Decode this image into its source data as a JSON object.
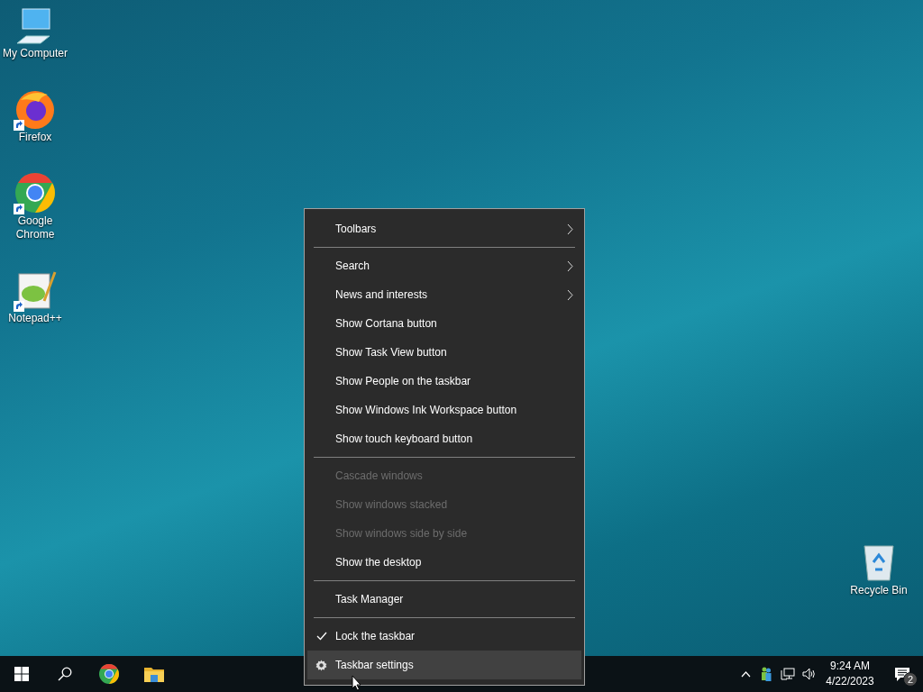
{
  "desktop_icons": [
    {
      "label": "My Computer",
      "kind": "computer",
      "shortcut": false
    },
    {
      "label": "Firefox",
      "kind": "firefox",
      "shortcut": true
    },
    {
      "label": "Google Chrome",
      "kind": "chrome",
      "shortcut": true
    },
    {
      "label": "Notepad++",
      "kind": "notepad",
      "shortcut": true
    }
  ],
  "recycle_bin": {
    "label": "Recycle Bin"
  },
  "context_menu": [
    {
      "kind": "item",
      "label": "Toolbars",
      "submenu": true,
      "disabled": false,
      "checked": false,
      "selected": false
    },
    {
      "kind": "separator"
    },
    {
      "kind": "item",
      "label": "Search",
      "submenu": true,
      "disabled": false,
      "checked": false,
      "selected": false
    },
    {
      "kind": "item",
      "label": "News and interests",
      "submenu": true,
      "disabled": false,
      "checked": false,
      "selected": false
    },
    {
      "kind": "item",
      "label": "Show Cortana button",
      "submenu": false,
      "disabled": false,
      "checked": false,
      "selected": false
    },
    {
      "kind": "item",
      "label": "Show Task View button",
      "submenu": false,
      "disabled": false,
      "checked": false,
      "selected": false
    },
    {
      "kind": "item",
      "label": "Show People on the taskbar",
      "submenu": false,
      "disabled": false,
      "checked": false,
      "selected": false
    },
    {
      "kind": "item",
      "label": "Show Windows Ink Workspace button",
      "submenu": false,
      "disabled": false,
      "checked": false,
      "selected": false
    },
    {
      "kind": "item",
      "label": "Show touch keyboard button",
      "submenu": false,
      "disabled": false,
      "checked": false,
      "selected": false
    },
    {
      "kind": "separator"
    },
    {
      "kind": "item",
      "label": "Cascade windows",
      "submenu": false,
      "disabled": true,
      "checked": false,
      "selected": false
    },
    {
      "kind": "item",
      "label": "Show windows stacked",
      "submenu": false,
      "disabled": true,
      "checked": false,
      "selected": false
    },
    {
      "kind": "item",
      "label": "Show windows side by side",
      "submenu": false,
      "disabled": true,
      "checked": false,
      "selected": false
    },
    {
      "kind": "item",
      "label": "Show the desktop",
      "submenu": false,
      "disabled": false,
      "checked": false,
      "selected": false
    },
    {
      "kind": "separator"
    },
    {
      "kind": "item",
      "label": "Task Manager",
      "submenu": false,
      "disabled": false,
      "checked": false,
      "selected": false
    },
    {
      "kind": "separator"
    },
    {
      "kind": "item",
      "label": "Lock the taskbar",
      "submenu": false,
      "disabled": false,
      "checked": true,
      "selected": false
    },
    {
      "kind": "settings",
      "label": "Taskbar settings",
      "submenu": false,
      "disabled": false,
      "checked": false,
      "selected": true
    }
  ],
  "taskbar": {
    "time": "9:24 AM",
    "date": "4/22/2023",
    "notification_count": "2"
  }
}
